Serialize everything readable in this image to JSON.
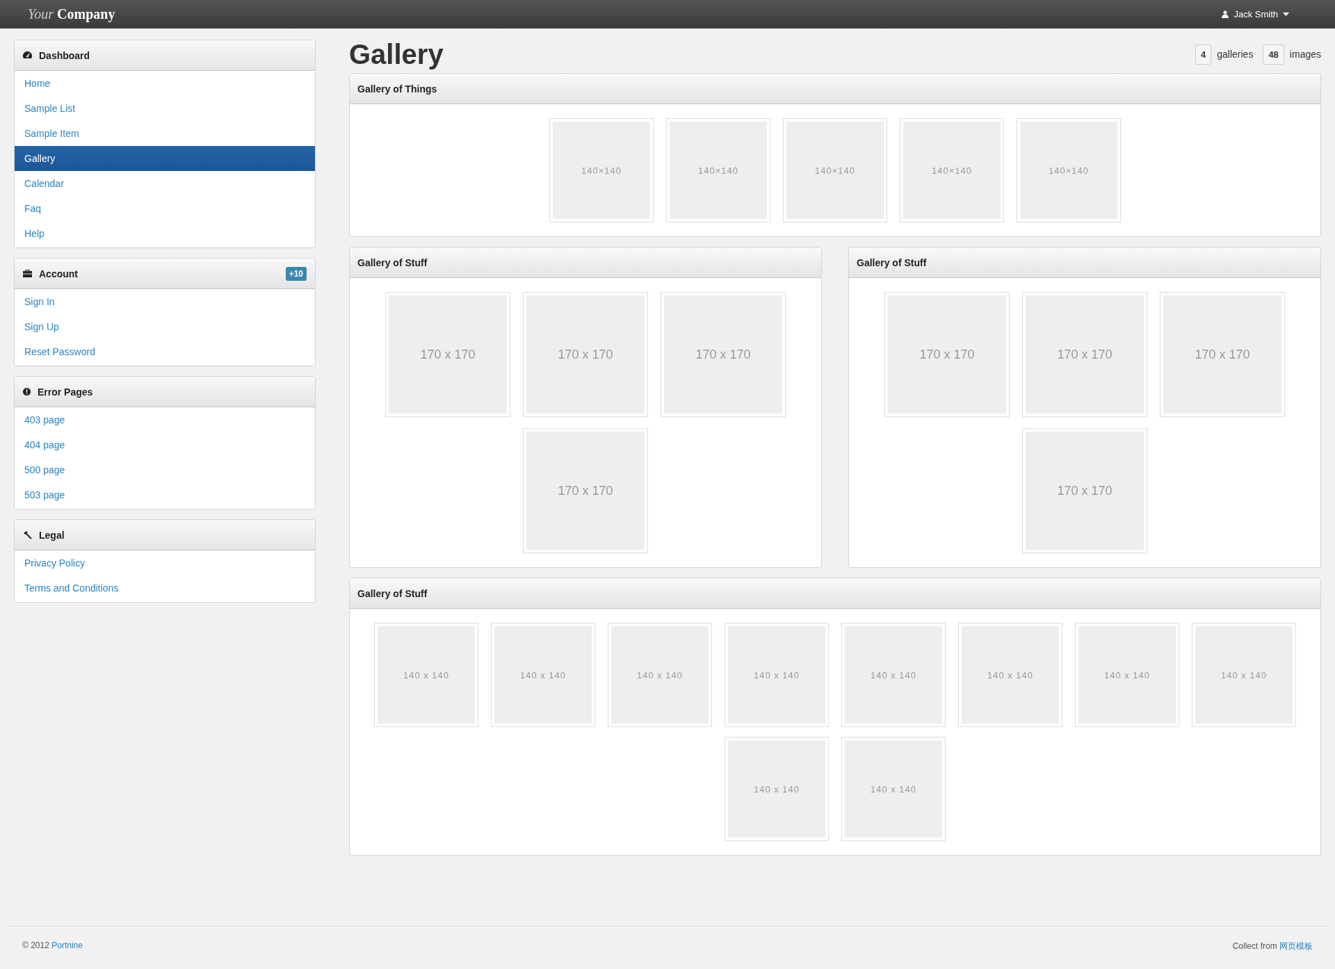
{
  "navbar": {
    "brand_light": "Your",
    "brand_bold": "Company",
    "user": "Jack Smith"
  },
  "sidebar": [
    {
      "title": "Dashboard",
      "items": [
        {
          "label": "Home",
          "selected": false
        },
        {
          "label": "Sample List",
          "selected": false
        },
        {
          "label": "Sample Item",
          "selected": false
        },
        {
          "label": "Gallery",
          "selected": true
        },
        {
          "label": "Calendar",
          "selected": false
        },
        {
          "label": "Faq",
          "selected": false
        },
        {
          "label": "Help",
          "selected": false
        }
      ]
    },
    {
      "title": "Account",
      "badge": "+10",
      "items": [
        {
          "label": "Sign In",
          "selected": false
        },
        {
          "label": "Sign Up",
          "selected": false
        },
        {
          "label": "Reset Password",
          "selected": false
        }
      ]
    },
    {
      "title": "Error Pages",
      "items": [
        {
          "label": "403 page",
          "selected": false
        },
        {
          "label": "404 page",
          "selected": false
        },
        {
          "label": "500 page",
          "selected": false
        },
        {
          "label": "503 page",
          "selected": false
        }
      ]
    },
    {
      "title": "Legal",
      "items": [
        {
          "label": "Privacy Policy",
          "selected": false
        },
        {
          "label": "Terms and Conditions",
          "selected": false
        }
      ]
    }
  ],
  "page": {
    "title": "Gallery",
    "stats": [
      {
        "count": "4",
        "label": "galleries"
      },
      {
        "count": "48",
        "label": "images"
      }
    ]
  },
  "galleries": [
    {
      "title": "Gallery of Things",
      "kind": "full",
      "images": [
        "140×140",
        "140×140",
        "140×140",
        "140×140",
        "140×140"
      ]
    },
    {
      "title": "Gallery of Stuff",
      "kind": "half",
      "images": [
        "170 x 170",
        "170 x 170",
        "170 x 170",
        "170 x 170"
      ]
    },
    {
      "title": "Gallery of Stuff",
      "kind": "half",
      "images": [
        "170 x 170",
        "170 x 170",
        "170 x 170",
        "170 x 170"
      ]
    },
    {
      "title": "Gallery of Stuff",
      "kind": "full",
      "images": [
        "140 x 140",
        "140 x 140",
        "140 x 140",
        "140 x 140",
        "140 x 140",
        "140 x 140",
        "140 x 140",
        "140 x 140",
        "140 x 140",
        "140 x 140"
      ]
    }
  ],
  "footer": {
    "copyright": "© 2012",
    "author": "Portnine",
    "credit": "Collect from",
    "credit_link": "网页模板"
  }
}
